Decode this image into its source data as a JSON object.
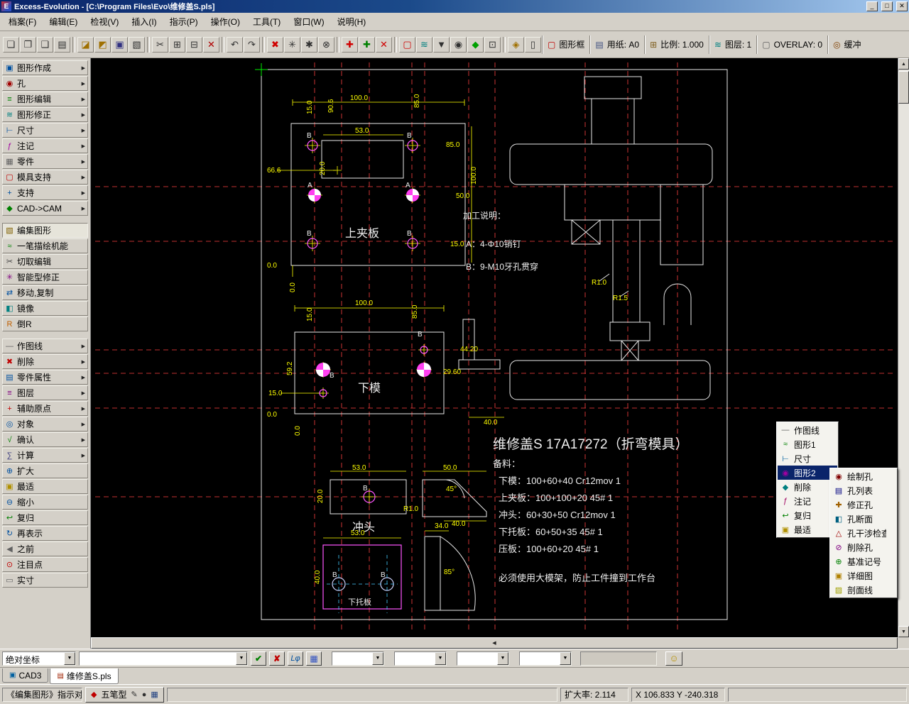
{
  "window": {
    "title": "Excess-Evolution - [C:\\Program Files\\Evo\\维修盖S.pls]",
    "app_letter": "E",
    "controls": {
      "minimize": "_",
      "maximize": "□",
      "close": "✕"
    }
  },
  "icons": {
    "arrow_right": "▶",
    "up": "▲",
    "down": "▼",
    "left": "◀",
    "right": "▶"
  },
  "menubar": {
    "items": [
      {
        "name": "menu-file",
        "label": "档案(F)"
      },
      {
        "name": "menu-edit",
        "label": "编辑(E)"
      },
      {
        "name": "menu-view",
        "label": "检视(V)"
      },
      {
        "name": "menu-insert",
        "label": "插入(I)"
      },
      {
        "name": "menu-command",
        "label": "指示(P)"
      },
      {
        "name": "menu-operate",
        "label": "操作(O)"
      },
      {
        "name": "menu-tools",
        "label": "工具(T)"
      },
      {
        "name": "menu-window",
        "label": "窗口(W)"
      },
      {
        "name": "menu-help",
        "label": "说明(H)"
      }
    ]
  },
  "toolbar": {
    "buttons": [
      {
        "name": "tb-new-file",
        "glyph": "❏",
        "color": "#303030"
      },
      {
        "name": "tb-open-doc",
        "glyph": "❐",
        "color": "#303030"
      },
      {
        "name": "tb-doc-stack",
        "glyph": "❑",
        "color": "#303030"
      },
      {
        "name": "tb-page-setup",
        "glyph": "▤",
        "color": "#303030"
      },
      {
        "sep": true
      },
      {
        "name": "tb-open-folder",
        "glyph": "◪",
        "color": "#a07000"
      },
      {
        "name": "tb-import-folder",
        "glyph": "◩",
        "color": "#a07000"
      },
      {
        "name": "tb-save-file",
        "glyph": "▣",
        "color": "#303080"
      },
      {
        "name": "tb-print",
        "glyph": "▧",
        "color": "#303030"
      },
      {
        "sep": true
      },
      {
        "name": "tb-cut",
        "glyph": "✂",
        "color": "#303030"
      },
      {
        "name": "tb-copy",
        "glyph": "⊞",
        "color": "#303030"
      },
      {
        "name": "tb-paste",
        "glyph": "⊟",
        "color": "#303030"
      },
      {
        "name": "tb-delete",
        "glyph": "✕",
        "color": "#b00000"
      },
      {
        "sep": true
      },
      {
        "name": "tb-undo",
        "glyph": "↶",
        "color": "#303030"
      },
      {
        "name": "tb-redo",
        "glyph": "↷",
        "color": "#303030"
      },
      {
        "sep": true
      },
      {
        "name": "tb-cancel",
        "glyph": "✖",
        "color": "#d00000"
      },
      {
        "name": "tb-snap-intersection",
        "glyph": "✳",
        "color": "#303030"
      },
      {
        "name": "tb-snap-endpoint",
        "glyph": "✱",
        "color": "#303030"
      },
      {
        "name": "tb-snap-off",
        "glyph": "⊗",
        "color": "#303030"
      },
      {
        "sep": true
      },
      {
        "name": "tb-add-point-red",
        "glyph": "✚",
        "color": "#d00000"
      },
      {
        "name": "tb-add-point-green",
        "glyph": "✚",
        "color": "#008000"
      },
      {
        "name": "tb-delete-point",
        "glyph": "✕",
        "color": "#d00000"
      },
      {
        "sep": true
      },
      {
        "name": "tb-frame-toggle",
        "glyph": "▢",
        "color": "#d00000"
      },
      {
        "name": "tb-layer-waves",
        "glyph": "≋",
        "color": "#008080"
      },
      {
        "name": "tb-display-filter",
        "glyph": "▼",
        "color": "#303030"
      },
      {
        "name": "tb-point-style",
        "glyph": "◉",
        "color": "#303030"
      },
      {
        "name": "tb-fill-style",
        "glyph": "◆",
        "color": "#00a000"
      },
      {
        "name": "tb-section-box",
        "glyph": "⊡",
        "color": "#303030"
      },
      {
        "sep": true
      },
      {
        "name": "tb-lock",
        "glyph": "◈",
        "color": "#a07000"
      },
      {
        "name": "tb-page-frame",
        "glyph": "▯",
        "color": "#303030"
      }
    ],
    "fields": [
      {
        "name": "field-frame",
        "icon": "▢",
        "color": "#c00000",
        "label": "图形框"
      },
      {
        "name": "field-paper",
        "icon": "▤",
        "color": "#405080",
        "label": "用纸: A0"
      },
      {
        "name": "field-scale",
        "icon": "⊞",
        "color": "#806020",
        "label": "比例: 1.000"
      },
      {
        "name": "field-layer",
        "icon": "≋",
        "color": "#008080",
        "label": "图层: 1"
      },
      {
        "name": "field-overlay",
        "icon": "▢",
        "color": "#606060",
        "label": "OVERLAY: 0"
      },
      {
        "name": "field-buffer",
        "icon": "◎",
        "color": "#804000",
        "label": "缓冲"
      }
    ]
  },
  "sidebar": {
    "group1": [
      {
        "name": "sb-shape-create",
        "icon": "▣",
        "color": "#0050a0",
        "label": "图形作成",
        "arrow": true
      },
      {
        "name": "sb-hole",
        "icon": "◉",
        "color": "#a00000",
        "label": "孔",
        "arrow": true
      },
      {
        "name": "sb-shape-edit",
        "icon": "≡",
        "color": "#008000",
        "label": "图形编辑",
        "arrow": true
      },
      {
        "name": "sb-shape-modify",
        "icon": "≋",
        "color": "#008080",
        "label": "图形修正",
        "arrow": true
      },
      {
        "name": "sb-dimension",
        "icon": "⊢",
        "color": "#0050a0",
        "label": "尺寸",
        "arrow": true
      },
      {
        "name": "sb-annotation",
        "icon": "ƒ",
        "color": "#a000a0",
        "label": "注记",
        "arrow": true
      },
      {
        "name": "sb-parts",
        "icon": "▦",
        "color": "#606060",
        "label": "零件",
        "arrow": true
      },
      {
        "name": "sb-mold-support",
        "icon": "▢",
        "color": "#c00000",
        "label": "模具支持",
        "arrow": true
      },
      {
        "name": "sb-support",
        "icon": "+",
        "color": "#0050a0",
        "label": "支持",
        "arrow": true
      },
      {
        "name": "sb-cad-cam",
        "icon": "◆",
        "color": "#008000",
        "label": "CAD->CAM",
        "arrow": true
      }
    ],
    "group2": [
      {
        "name": "sb-edit-shape",
        "icon": "▧",
        "color": "#806000",
        "label": "编集图形",
        "selected": true
      },
      {
        "name": "sb-one-stroke",
        "icon": "≈",
        "color": "#008000",
        "label": "一笔描绘机能"
      },
      {
        "name": "sb-cut-edit",
        "icon": "✂",
        "color": "#404040",
        "label": "切取编辑"
      },
      {
        "name": "sb-smart-modify",
        "icon": "✳",
        "color": "#800080",
        "label": "智能型修正"
      },
      {
        "name": "sb-move-copy",
        "icon": "⇄",
        "color": "#0050a0",
        "label": "移动,复制"
      },
      {
        "name": "sb-mirror",
        "icon": "◧",
        "color": "#008080",
        "label": "镜像"
      },
      {
        "name": "sb-fillet",
        "icon": "R",
        "color": "#c06000",
        "label": "倒R"
      }
    ],
    "group3": [
      {
        "name": "sb-construction-line",
        "icon": "—",
        "color": "#606060",
        "label": "作图线",
        "arrow": true
      },
      {
        "name": "sb-erase",
        "icon": "✖",
        "color": "#c00000",
        "label": "削除",
        "arrow": true
      },
      {
        "name": "sb-part-props",
        "icon": "▤",
        "color": "#0050a0",
        "label": "零件属性",
        "arrow": true
      },
      {
        "name": "sb-layers",
        "icon": "≡",
        "color": "#800080",
        "label": "图层",
        "arrow": true
      },
      {
        "name": "sb-aux-origin",
        "icon": "+",
        "color": "#c00000",
        "label": "辅助原点",
        "arrow": true
      },
      {
        "name": "sb-object",
        "icon": "◎",
        "color": "#0050a0",
        "label": "对象",
        "arrow": true
      },
      {
        "name": "sb-confirm",
        "icon": "√",
        "color": "#008000",
        "label": "确认",
        "arrow": true
      },
      {
        "name": "sb-calculate",
        "icon": "∑",
        "color": "#404080",
        "label": "计算",
        "arrow": true
      },
      {
        "name": "sb-zoom-in",
        "icon": "⊕",
        "color": "#0050a0",
        "label": "扩大"
      },
      {
        "name": "sb-zoom-fit",
        "icon": "▣",
        "color": "#b09000",
        "label": "最适"
      },
      {
        "name": "sb-zoom-out",
        "icon": "⊖",
        "color": "#0050a0",
        "label": "缩小"
      },
      {
        "name": "sb-zoom-back",
        "icon": "↩",
        "color": "#008000",
        "label": "复归"
      },
      {
        "name": "sb-redraw",
        "icon": "↻",
        "color": "#0050a0",
        "label": "再表示"
      },
      {
        "name": "sb-previous",
        "icon": "◀",
        "color": "#606060",
        "label": "之前"
      },
      {
        "name": "sb-focus-point",
        "icon": "⊙",
        "color": "#c00000",
        "label": "注目点"
      },
      {
        "name": "sb-actual-size",
        "icon": "▭",
        "color": "#606060",
        "label": "实寸"
      }
    ]
  },
  "context_menu": {
    "items": [
      {
        "name": "ctx-construction-line",
        "icon": "—",
        "color": "#606060",
        "label": "作图线"
      },
      {
        "name": "ctx-shape1",
        "icon": "≈",
        "color": "#008000",
        "label": "图形1"
      },
      {
        "name": "ctx-dimension",
        "icon": "⊢",
        "color": "#0060a0",
        "label": "尺寸"
      },
      {
        "name": "ctx-shape2",
        "icon": "◉",
        "color": "#a000a0",
        "label": "图形2",
        "selected": true,
        "arrow": true
      },
      {
        "name": "ctx-erase",
        "icon": "◆",
        "color": "#008080",
        "label": "削除"
      },
      {
        "name": "ctx-annotation",
        "icon": "ƒ",
        "color": "#a00060",
        "label": "注记"
      },
      {
        "name": "ctx-restore",
        "icon": "↩",
        "color": "#008000",
        "label": "复归"
      },
      {
        "name": "ctx-fit",
        "icon": "▣",
        "color": "#b09000",
        "label": "最适"
      }
    ],
    "submenu": [
      {
        "name": "ctx-draw-hole",
        "icon": "◉",
        "color": "#800000",
        "label": "绘制孔"
      },
      {
        "name": "ctx-hole-list",
        "icon": "▤",
        "color": "#000080",
        "label": "孔列表"
      },
      {
        "name": "ctx-modify-hole",
        "icon": "✚",
        "color": "#a06000",
        "label": "修正孔"
      },
      {
        "name": "ctx-hole-section",
        "icon": "◧",
        "color": "#006080",
        "label": "孔断面"
      },
      {
        "name": "ctx-hole-interference",
        "icon": "△",
        "color": "#a00000",
        "label": "孔干涉检查"
      },
      {
        "name": "ctx-erase-hole",
        "icon": "⊘",
        "color": "#800080",
        "label": "削除孔"
      },
      {
        "name": "ctx-datum-mark",
        "icon": "⊕",
        "color": "#008000",
        "label": "基准记号"
      },
      {
        "name": "ctx-detail-view",
        "icon": "▣",
        "color": "#b08000",
        "label": "详细图"
      },
      {
        "name": "ctx-hatch",
        "icon": "▨",
        "color": "#a0a000",
        "label": "剖面线"
      }
    ]
  },
  "drawing": {
    "title": "维修盖S  17A17272（折弯模具）",
    "labels": {
      "top_plate": "上夹板",
      "bottom_die": "下模",
      "punch": "冲头",
      "lower_plate": "下托板"
    },
    "letter_a": "A",
    "letter_b": "B",
    "notes": [
      "加工说明：",
      "A：4-Φ10销钉",
      "B：9-M10牙孔贯穿"
    ],
    "materials": [
      "备料：",
      "下模：100+60+40  Cr12mov  1",
      "上夹板：100+100+20  45#  1",
      "冲头：60+30+50  Cr12mov  1",
      "下托板：60+50+35  45#  1",
      "压板：100+60+20  45#  1"
    ],
    "warning": "必须使用大模架，防止工件撞到工作台",
    "dims": [
      "100.0",
      "15.0",
      "90.6",
      "85.0",
      "53.0",
      "85.0",
      "66.6",
      "20.0",
      "50.0",
      "100.0",
      "15.0",
      "0.0",
      "0.0",
      "100.0",
      "15.0",
      "85.0",
      "59.2",
      "15.0",
      "0.0",
      "0.0",
      "44.20",
      "29.60",
      "40.0",
      "R1.0",
      "R1.5",
      "53.0",
      "20.0",
      "R1.0",
      "45°",
      "50.0",
      "40.0",
      "53.0",
      "40.0",
      "34.0",
      "85°"
    ]
  },
  "coordbar": {
    "mode_value": "绝对坐标",
    "input_value": "",
    "ok_glyph": "✔",
    "cancel_glyph": "✘",
    "lphi_label": "Lφ",
    "grid_glyph": "▦",
    "combos": [
      "",
      "",
      "",
      ""
    ],
    "field_value": "",
    "smiley_glyph": "☺"
  },
  "tabs": {
    "items": [
      {
        "name": "tab-cad3",
        "label": "CAD3",
        "icon": "▣",
        "color": "#0060a0"
      },
      {
        "name": "tab-file",
        "label": "维修盖S.pls",
        "icon": "▤",
        "color": "#a02000",
        "active": true
      }
    ]
  },
  "statusbar": {
    "mode_text": "《编集图形》指示对象",
    "ime": {
      "prefix_icon": "◆",
      "label": "五笔型",
      "suffix_icons": [
        "✎",
        "●",
        "▦"
      ]
    },
    "zoom_text": "扩大率: 2.114",
    "coords_text": "X 106.833 Y -240.318"
  }
}
